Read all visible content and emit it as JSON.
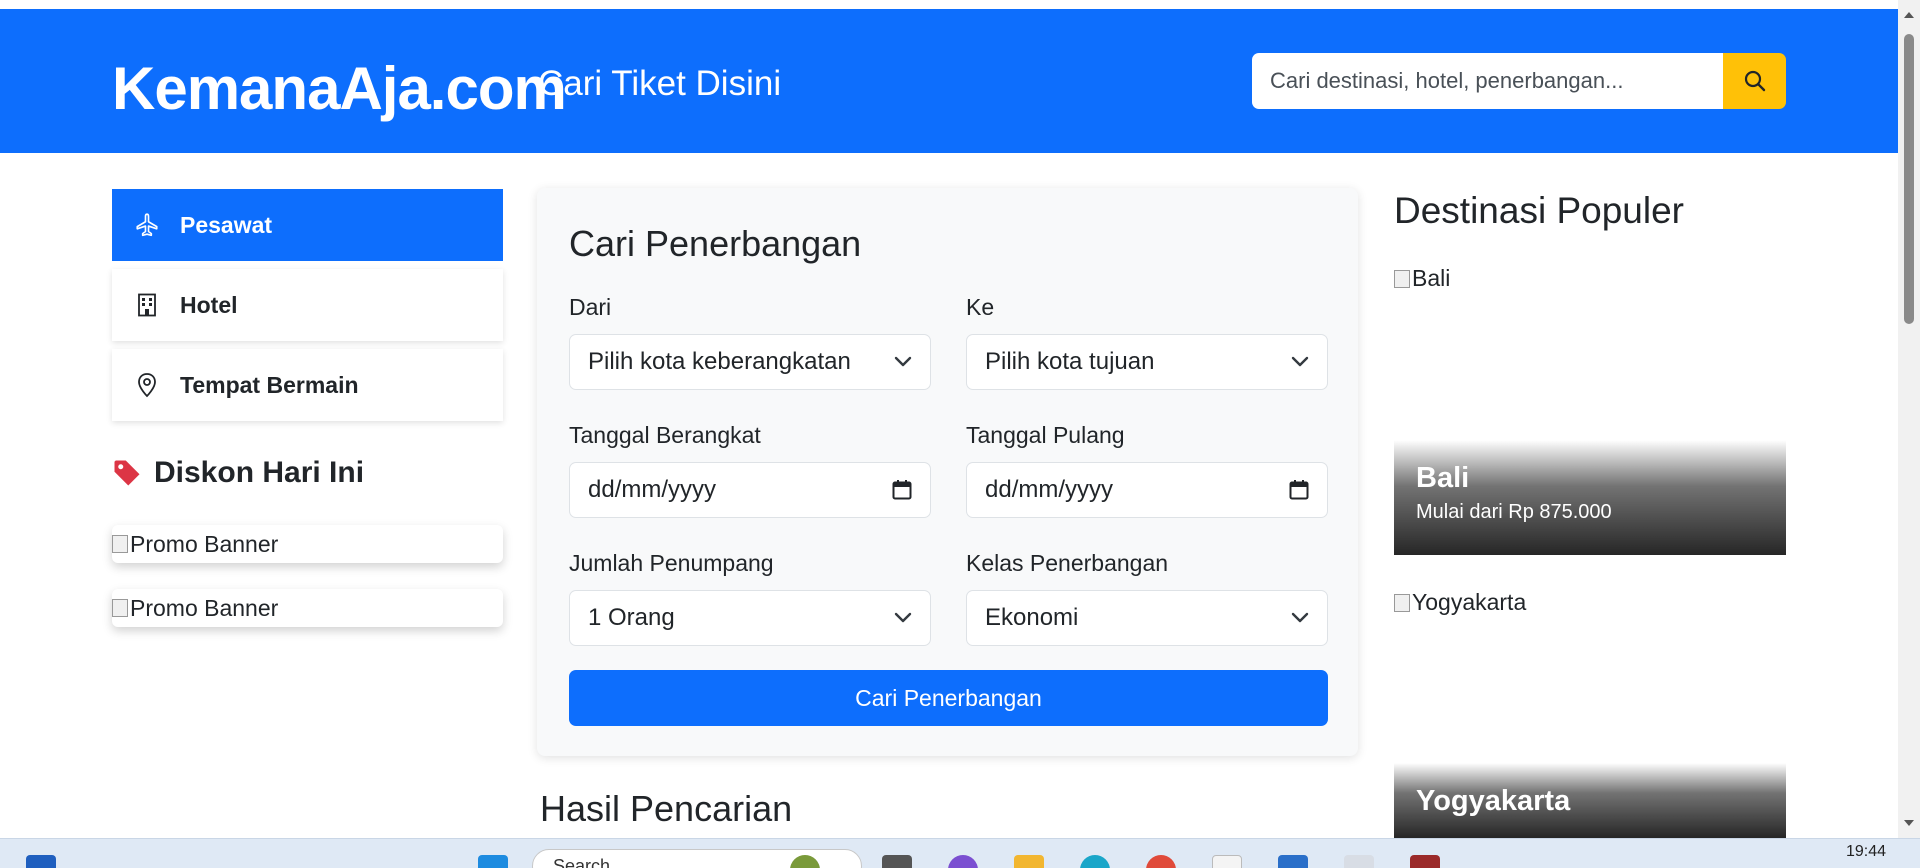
{
  "header": {
    "brand": "KemanaAja.com",
    "tagline": "Cari Tiket Disini",
    "search_placeholder": "Cari destinasi, hotel, penerbangan..."
  },
  "sidebar": {
    "items": [
      {
        "label": "Pesawat",
        "icon": "airplane-icon",
        "active": true
      },
      {
        "label": "Hotel",
        "icon": "building-icon",
        "active": false
      },
      {
        "label": "Tempat Bermain",
        "icon": "map-pin-icon",
        "active": false
      }
    ],
    "discount_title": "Diskon Hari Ini",
    "promos": [
      "Promo Banner",
      "Promo Banner"
    ]
  },
  "form": {
    "title": "Cari Penerbangan",
    "from_label": "Dari",
    "from_value": "Pilih kota keberangkatan",
    "to_label": "Ke",
    "to_value": "Pilih kota tujuan",
    "depart_label": "Tanggal Berangkat",
    "depart_value": "dd/mm/yyyy",
    "return_label": "Tanggal Pulang",
    "return_value": "dd/mm/yyyy",
    "passengers_label": "Jumlah Penumpang",
    "passengers_value": "1 Orang",
    "class_label": "Kelas Penerbangan",
    "class_value": "Ekonomi",
    "submit_label": "Cari Penerbangan"
  },
  "results": {
    "title": "Hasil Pencarian"
  },
  "destinations": {
    "title": "Destinasi Populer",
    "items": [
      {
        "alt": "Bali",
        "name": "Bali",
        "price": "Mulai dari Rp 875.000"
      },
      {
        "alt": "Yogyakarta",
        "name": "Yogyakarta"
      }
    ]
  },
  "taskbar": {
    "search_label": "Search",
    "clock": "19:44"
  },
  "colors": {
    "primary": "#0d6efd",
    "warning": "#ffc107",
    "danger": "#dc3545"
  }
}
